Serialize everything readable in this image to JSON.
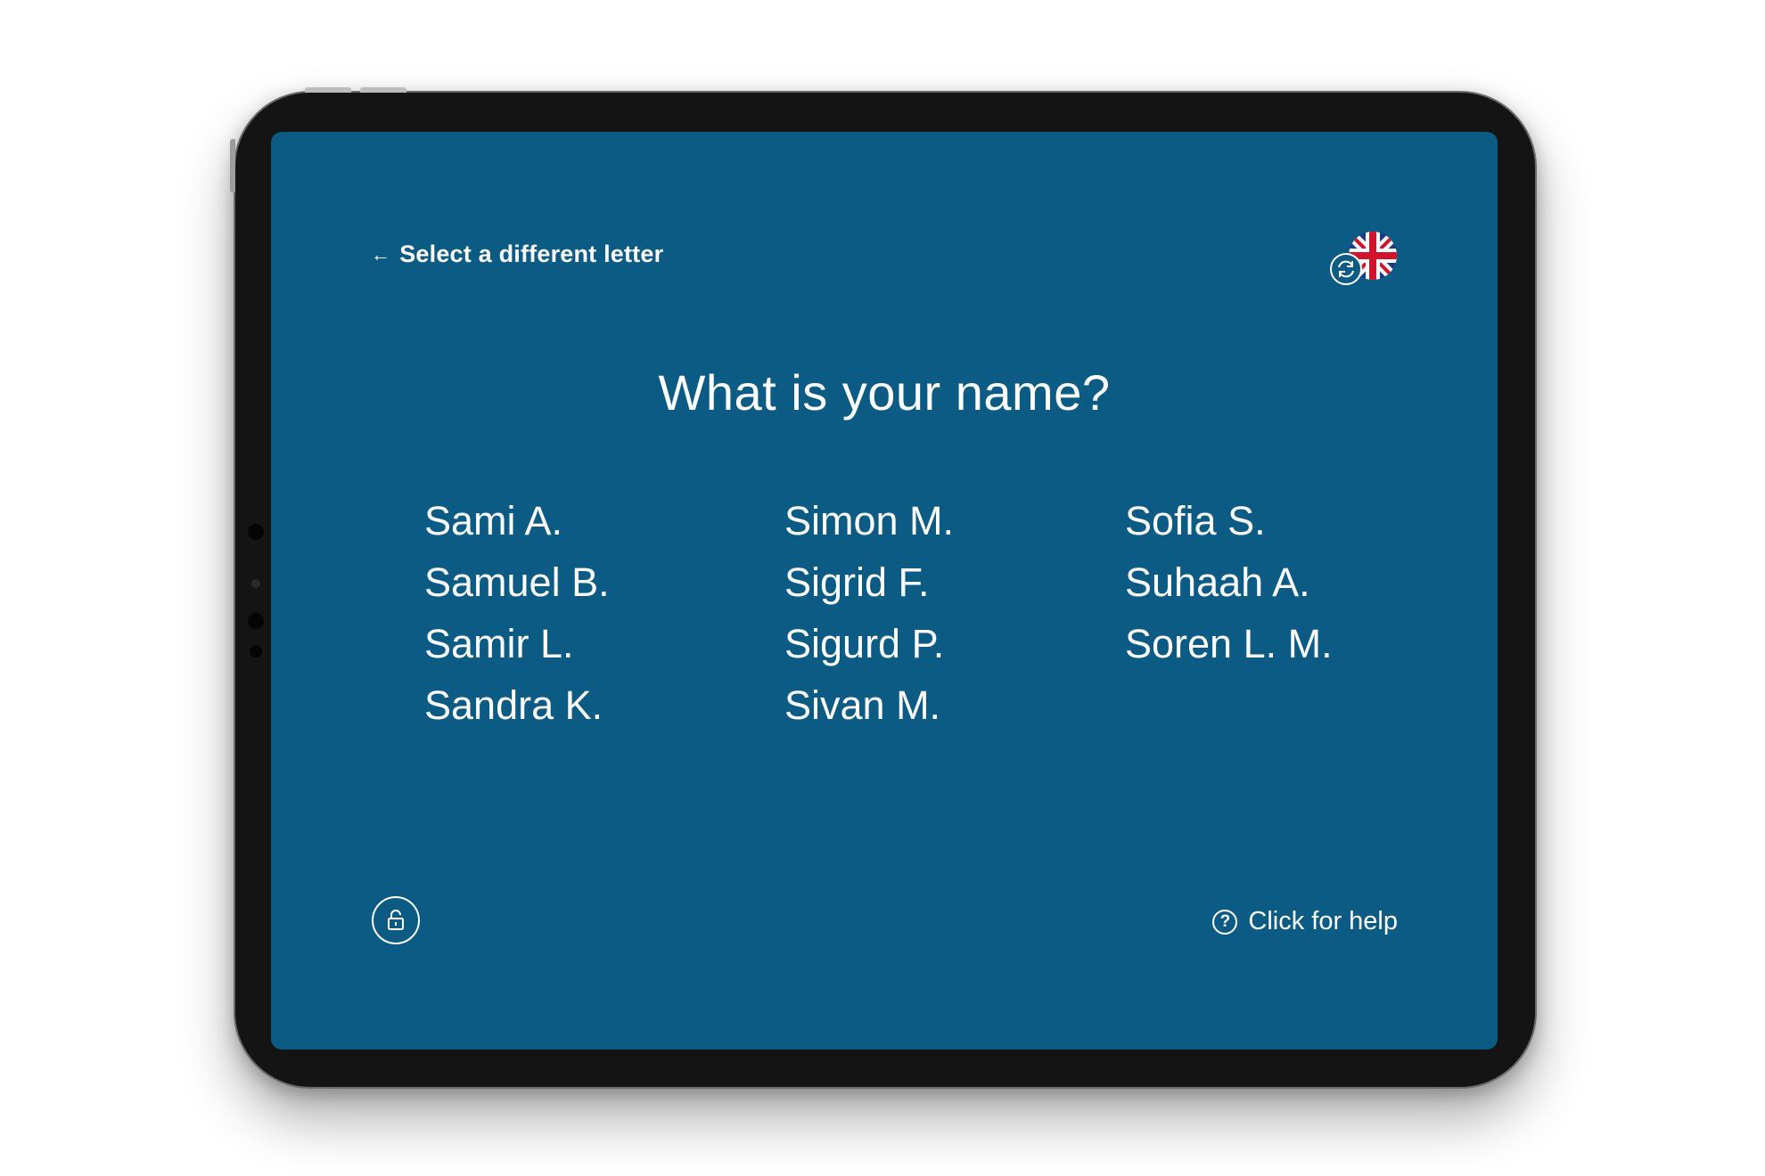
{
  "nav": {
    "back_icon": "arrow-left-icon",
    "back_label": "Select a different letter"
  },
  "language": {
    "icon": "uk-flag-icon",
    "switch_icon": "refresh-icon"
  },
  "page": {
    "title": "What is your name?"
  },
  "names": {
    "col1": [
      "Sami A.",
      "Samuel B.",
      "Samir L.",
      "Sandra K."
    ],
    "col2": [
      "Simon M.",
      "Sigrid F.",
      "Sigurd P.",
      "Sivan M."
    ],
    "col3": [
      "Sofia S.",
      "Suhaah A.",
      "Soren L. M."
    ]
  },
  "footer": {
    "lock_icon": "unlock-icon",
    "help_icon": "question-circle-icon",
    "help_label": "Click for help"
  },
  "colors": {
    "screen_background": "#0b5b84",
    "text": "#ffffff",
    "device_frame": "#141414"
  }
}
